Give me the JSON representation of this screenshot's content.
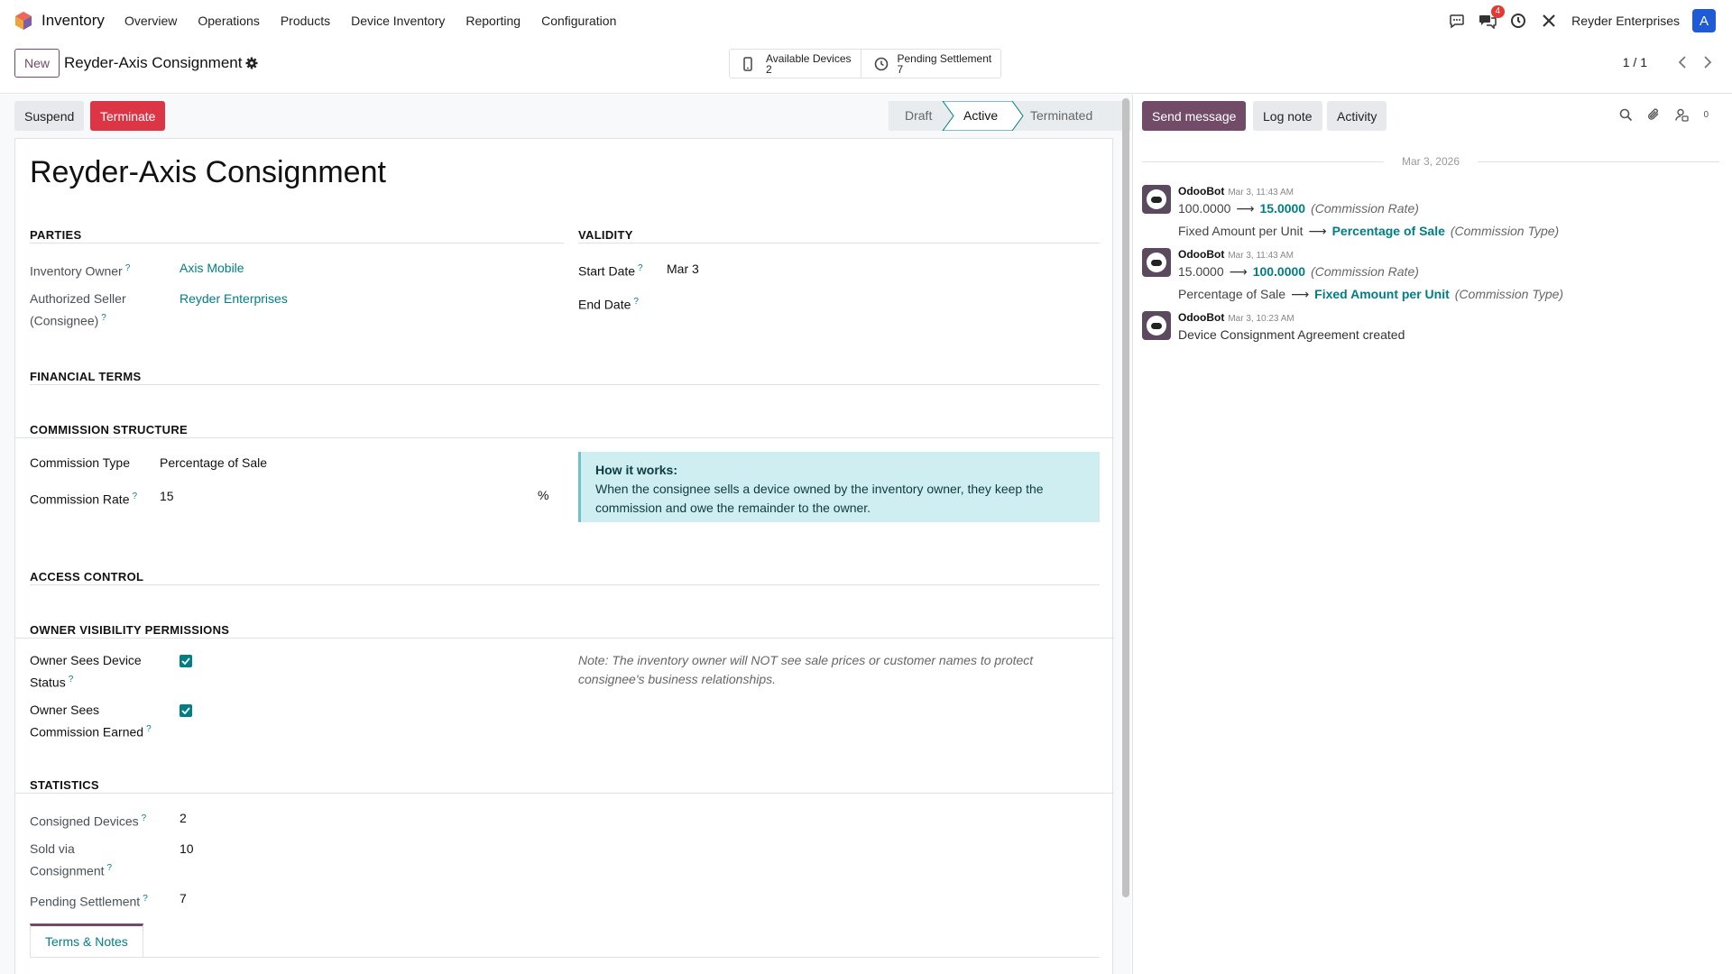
{
  "navbar": {
    "app_name": "Inventory",
    "menu": [
      "Overview",
      "Operations",
      "Products",
      "Device Inventory",
      "Reporting",
      "Configuration"
    ],
    "messages_badge": "4",
    "company": "Reyder Enterprises",
    "avatar_letter": "A"
  },
  "control": {
    "new_label": "New",
    "record_title": "Reyder-Axis Consignment",
    "smart_buttons": [
      {
        "label": "Available Devices",
        "value": "2",
        "icon": "phone-icon"
      },
      {
        "label": "Pending Settlement",
        "value": "7",
        "icon": "clock-icon"
      }
    ],
    "pager": "1 / 1"
  },
  "statusbar": {
    "suspend_label": "Suspend",
    "terminate_label": "Terminate",
    "stages": [
      "Draft",
      "Active",
      "Terminated"
    ],
    "active_stage": "Active"
  },
  "form": {
    "title": "Reyder-Axis Consignment",
    "parties": {
      "heading": "PARTIES",
      "owner_label": "Inventory Owner",
      "owner_value": "Axis Mobile",
      "seller_label_1": "Authorized Seller",
      "seller_label_2": "(Consignee)",
      "seller_value": "Reyder Enterprises"
    },
    "validity": {
      "heading": "VALIDITY",
      "start_label": "Start Date",
      "start_value": "Mar 3",
      "end_label": "End Date"
    },
    "financial_heading": "FINANCIAL TERMS",
    "commission": {
      "heading": "COMMISSION STRUCTURE",
      "type_label": "Commission Type",
      "type_value": "Percentage of Sale",
      "rate_label": "Commission Rate",
      "rate_value": "15",
      "rate_unit": "%",
      "info_title": "How it works:",
      "info_text": "When the consignee sells a device owned by the inventory owner, they keep the commission and owe the remainder to the owner."
    },
    "access_heading": "ACCESS CONTROL",
    "visibility": {
      "heading": "OWNER VISIBILITY PERMISSIONS",
      "status_label_1": "Owner Sees Device",
      "status_label_2": "Status",
      "commission_label_1": "Owner Sees",
      "commission_label_2": "Commission Earned",
      "status_checked": true,
      "commission_checked": true,
      "note": "Note: The inventory owner will NOT see sale prices or customer names to protect consignee's business relationships."
    },
    "statistics": {
      "heading": "STATISTICS",
      "consigned_label": "Consigned Devices",
      "consigned_value": "2",
      "sold_label_1": "Sold via",
      "sold_label_2": "Consignment",
      "sold_value": "10",
      "pending_label": "Pending Settlement",
      "pending_value": "7"
    },
    "tab_label": "Terms & Notes",
    "help_mark": "?"
  },
  "chatter": {
    "send_label": "Send message",
    "log_label": "Log note",
    "activity_label": "Activity",
    "followers": "0",
    "date_separator": "Mar 3, 2026",
    "messages": [
      {
        "author": "OdooBot",
        "date": "Mar 3, 11:43 AM",
        "changes": [
          {
            "old": "100.0000",
            "new": "15.0000",
            "field": "(Commission Rate)"
          },
          {
            "old": "Fixed Amount per Unit",
            "new": "Percentage of Sale",
            "field": "(Commission Type)"
          }
        ]
      },
      {
        "author": "OdooBot",
        "date": "Mar 3, 11:43 AM",
        "changes": [
          {
            "old": "15.0000",
            "new": "100.0000",
            "field": "(Commission Rate)"
          },
          {
            "old": "Percentage of Sale",
            "new": "Fixed Amount per Unit",
            "field": "(Commission Type)"
          }
        ]
      },
      {
        "author": "OdooBot",
        "date": "Mar 3, 10:23 AM",
        "body": "Device Consignment Agreement created"
      }
    ]
  },
  "colors": {
    "brand": "#714b67",
    "accent": "#017e84",
    "danger": "#dc3545"
  }
}
